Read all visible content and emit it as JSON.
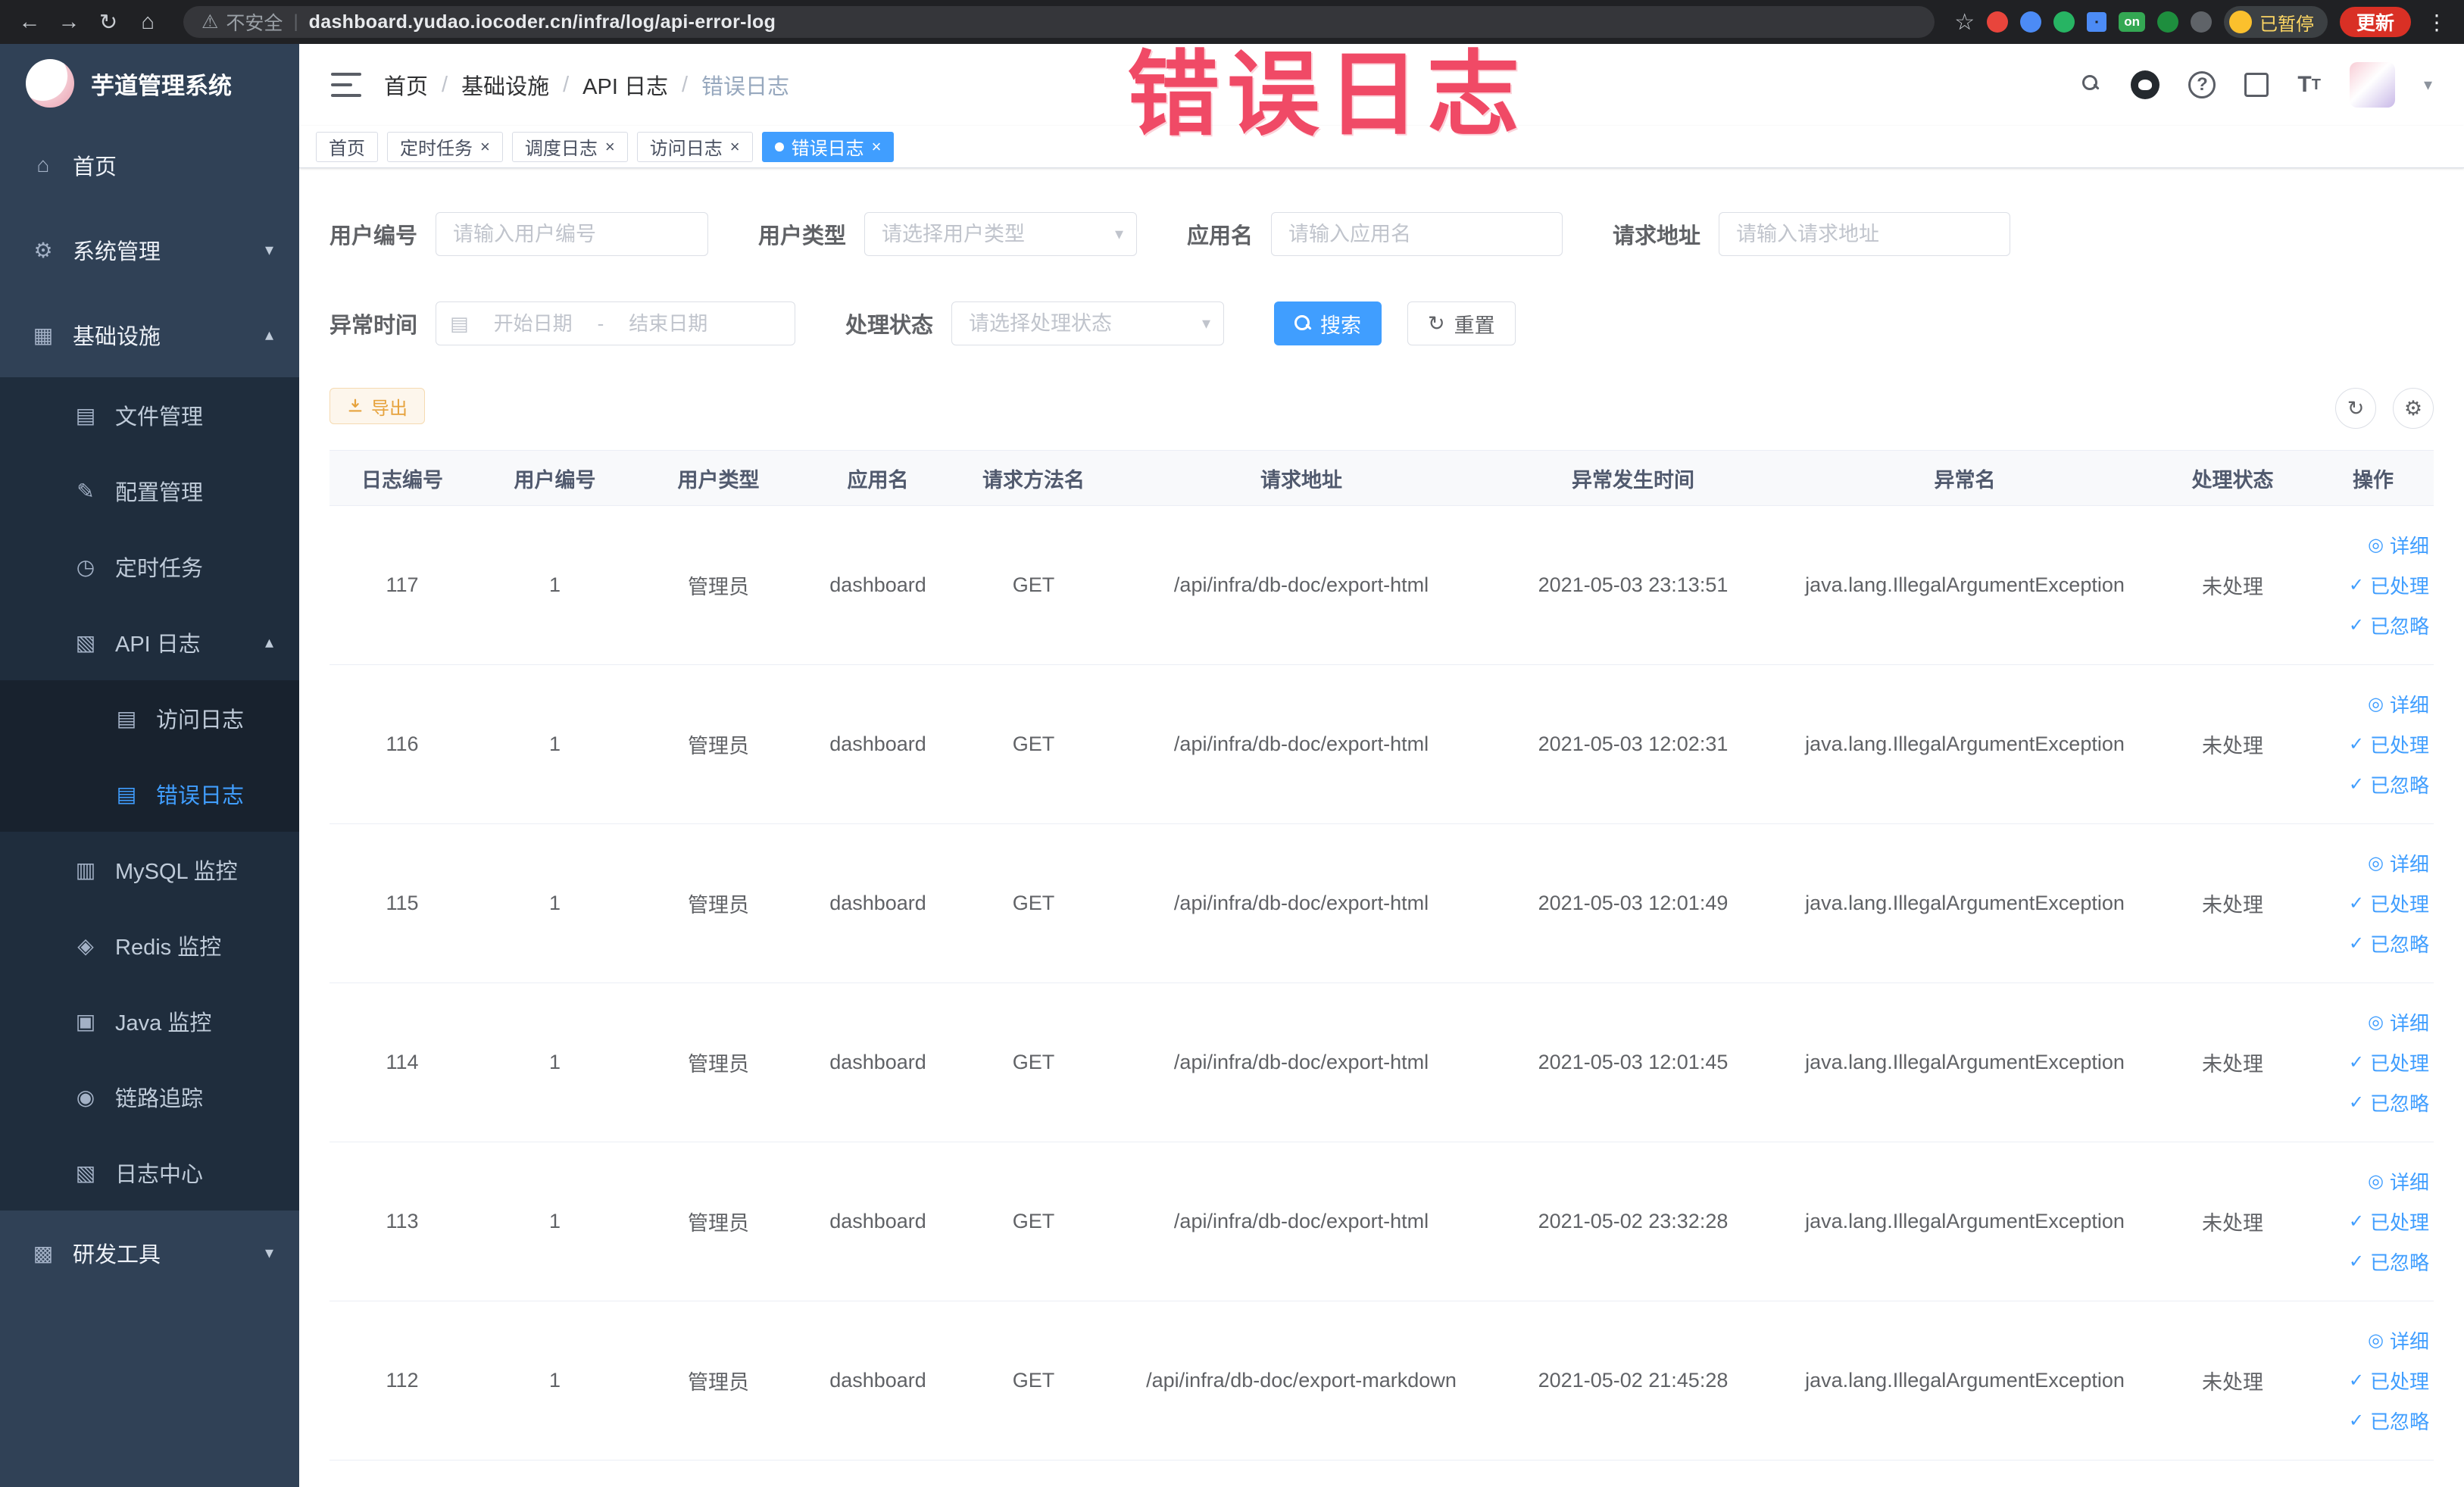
{
  "browser": {
    "security_label": "不安全",
    "url": "dashboard.yudao.iocoder.cn/infra/log/api-error-log",
    "on_badge": "on",
    "profile_badge": "已暂停",
    "update_label": "更新"
  },
  "watermark": "错误日志",
  "sidebar": {
    "logo_title": "芋道管理系统",
    "items": [
      {
        "label": "首页"
      },
      {
        "label": "系统管理"
      },
      {
        "label": "基础设施"
      },
      {
        "label": "文件管理"
      },
      {
        "label": "配置管理"
      },
      {
        "label": "定时任务"
      },
      {
        "label": "API 日志"
      },
      {
        "label": "访问日志"
      },
      {
        "label": "错误日志"
      },
      {
        "label": "MySQL 监控"
      },
      {
        "label": "Redis 监控"
      },
      {
        "label": "Java 监控"
      },
      {
        "label": "链路追踪"
      },
      {
        "label": "日志中心"
      },
      {
        "label": "研发工具"
      }
    ]
  },
  "header": {
    "breadcrumb": [
      "首页",
      "基础设施",
      "API 日志",
      "错误日志"
    ]
  },
  "tabs": [
    {
      "label": "首页"
    },
    {
      "label": "定时任务"
    },
    {
      "label": "调度日志"
    },
    {
      "label": "访问日志"
    },
    {
      "label": "错误日志"
    }
  ],
  "filters": {
    "user_id_label": "用户编号",
    "user_id_placeholder": "请输入用户编号",
    "user_type_label": "用户类型",
    "user_type_placeholder": "请选择用户类型",
    "app_name_label": "应用名",
    "app_name_placeholder": "请输入应用名",
    "request_url_label": "请求地址",
    "request_url_placeholder": "请输入请求地址",
    "exception_time_label": "异常时间",
    "start_date_placeholder": "开始日期",
    "end_date_placeholder": "结束日期",
    "date_separator": "-",
    "process_status_label": "处理状态",
    "process_status_placeholder": "请选择处理状态",
    "search_button": "搜索",
    "reset_button": "重置",
    "export_button": "导出"
  },
  "table": {
    "columns": [
      "日志编号",
      "用户编号",
      "用户类型",
      "应用名",
      "请求方法名",
      "请求地址",
      "异常发生时间",
      "异常名",
      "处理状态",
      "操作"
    ],
    "actions": [
      "详细",
      "已处理",
      "已忽略"
    ],
    "rows": [
      [
        "117",
        "1",
        "管理员",
        "dashboard",
        "GET",
        "/api/infra/db-doc/export-html",
        "2021-05-03 23:13:51",
        "java.lang.IllegalArgumentException",
        "未处理"
      ],
      [
        "116",
        "1",
        "管理员",
        "dashboard",
        "GET",
        "/api/infra/db-doc/export-html",
        "2021-05-03 12:02:31",
        "java.lang.IllegalArgumentException",
        "未处理"
      ],
      [
        "115",
        "1",
        "管理员",
        "dashboard",
        "GET",
        "/api/infra/db-doc/export-html",
        "2021-05-03 12:01:49",
        "java.lang.IllegalArgumentException",
        "未处理"
      ],
      [
        "114",
        "1",
        "管理员",
        "dashboard",
        "GET",
        "/api/infra/db-doc/export-html",
        "2021-05-03 12:01:45",
        "java.lang.IllegalArgumentException",
        "未处理"
      ],
      [
        "113",
        "1",
        "管理员",
        "dashboard",
        "GET",
        "/api/infra/db-doc/export-html",
        "2021-05-02 23:32:28",
        "java.lang.IllegalArgumentException",
        "未处理"
      ],
      [
        "112",
        "1",
        "管理员",
        "dashboard",
        "GET",
        "/api/infra/db-doc/export-markdown",
        "2021-05-02 21:45:28",
        "java.lang.IllegalArgumentException",
        "未处理"
      ]
    ]
  },
  "colors": {
    "accent": "#409EFF",
    "warning": "#E6A23C",
    "sidebar_bg": "#304156",
    "submenu_bg": "#1F2D3D",
    "submenu_deep_bg": "#18222E",
    "watermark": "#EF3B5A",
    "chrome_bg": "#202124"
  }
}
